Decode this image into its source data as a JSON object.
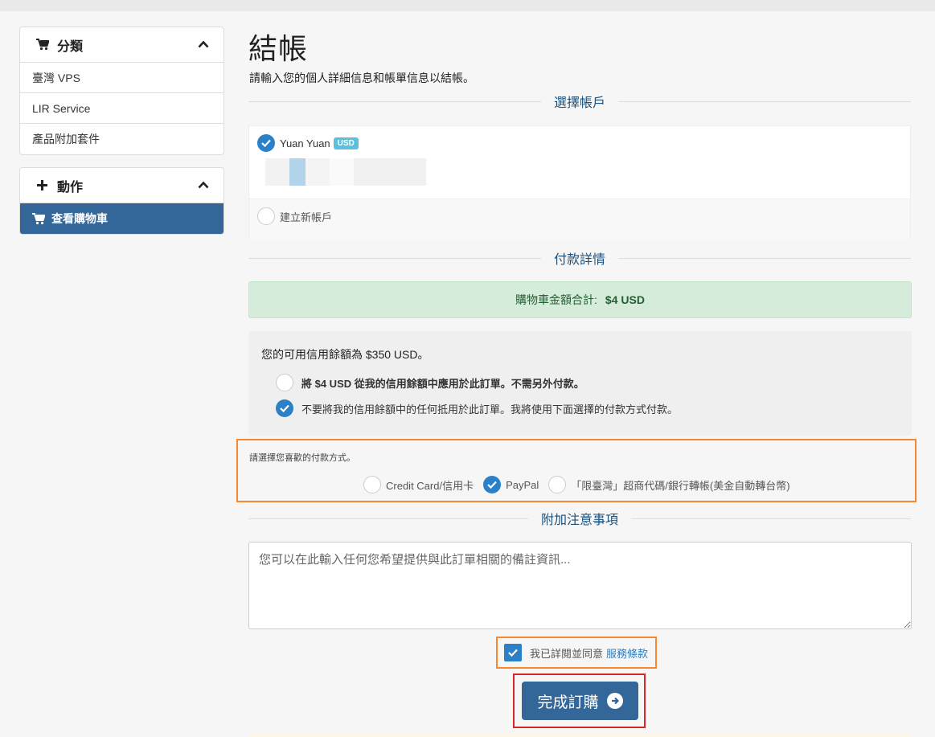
{
  "sidebar": {
    "categories": {
      "title": "分類",
      "icon": "cart-icon",
      "items": [
        {
          "label": "臺灣 VPS"
        },
        {
          "label": "LIR Service"
        },
        {
          "label": "產品附加套件"
        }
      ]
    },
    "actions": {
      "title": "動作",
      "icon": "plus-icon",
      "items": [
        {
          "label": "查看購物車",
          "active": true
        }
      ]
    }
  },
  "page": {
    "title": "結帳",
    "subtitle": "請輸入您的個人詳細信息和帳單信息以結帳。"
  },
  "account": {
    "section_title": "選擇帳戶",
    "selected_name": "Yuan Yuan",
    "currency_badge": "USD",
    "new_account_label": "建立新帳戶"
  },
  "payment": {
    "section_title": "付款詳情",
    "total_label": "購物車金額合計:",
    "total_value": "$4 USD",
    "credit_title": "您的可用信用餘額為 $350 USD。",
    "credit_option_apply": "將 $4 USD 從我的信用餘額中應用於此訂單。不需另外付款。",
    "credit_option_skip": "不要將我的信用餘額中的任何抵用於此訂單。我將使用下面選擇的付款方式付款。",
    "method_prompt": "請選擇您喜歡的付款方式。",
    "methods": [
      {
        "label": "Credit Card/信用卡",
        "selected": false
      },
      {
        "label": "PayPal",
        "selected": true
      },
      {
        "label": "「限臺灣」超商代碼/銀行轉帳(美金自動轉台幣)",
        "selected": false
      }
    ]
  },
  "notes": {
    "section_title": "附加注意事項",
    "placeholder": "您可以在此輸入任何您希望提供與此訂單相關的備註資訊..."
  },
  "tos": {
    "text": "我已詳閱並同意",
    "link": "服務條款",
    "checked": true
  },
  "submit": {
    "label": "完成訂購",
    "color": "#336699"
  },
  "colors": {
    "primary": "#336699",
    "highlight_orange": "#f7882f",
    "highlight_red": "#d9252a",
    "check_blue": "#2b80c8"
  }
}
